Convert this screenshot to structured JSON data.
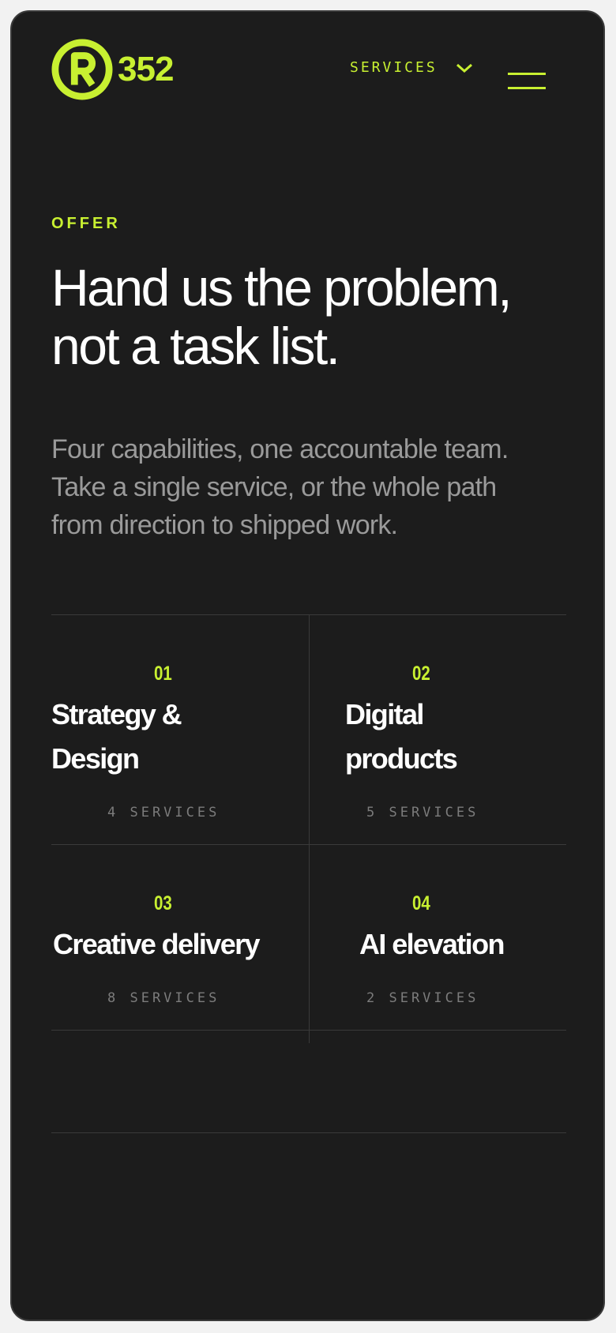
{
  "header": {
    "logo_text": "352",
    "logo_letter": "R",
    "services_label": "SERVICES",
    "services_icon": "chevron-down-icon",
    "menu_icon": "hamburger-menu-icon"
  },
  "hero": {
    "eyebrow": "OFFER",
    "headline_line1": "Hand us the problem,",
    "headline_line2": "not a task list.",
    "lede_line1": "Four capabilities, one accountable team.",
    "lede_line2": "Take a single service, or the whole path",
    "lede_line3": "from direction to shipped work."
  },
  "services": [
    {
      "number": "01",
      "title": "Strategy &\nDesign",
      "count": "4 SERVICES"
    },
    {
      "number": "02",
      "title": "Digital\nproducts",
      "count": "5 SERVICES"
    },
    {
      "number": "03",
      "title": "Creative delivery",
      "count": "8 SERVICES"
    },
    {
      "number": "04",
      "title": "AI elevation",
      "count": "2 SERVICES"
    }
  ],
  "colors": {
    "accent": "#c8f031",
    "background": "#1c1c1c",
    "text": "#ffffff",
    "muted": "#9a9a9a",
    "divider": "#3a3a3a"
  }
}
